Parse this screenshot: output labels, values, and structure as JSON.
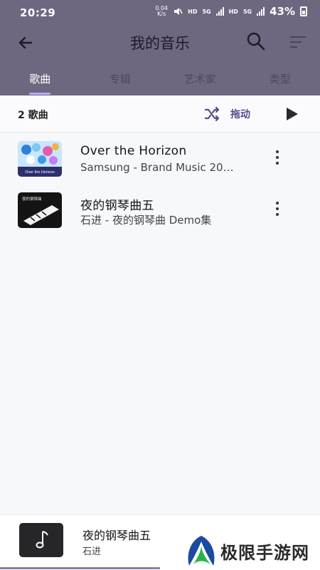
{
  "status_bar": {
    "time": "20:29",
    "net_speed_value": "0.04",
    "net_speed_unit": "K/s",
    "hd1": "HD",
    "net1": "5G",
    "hd2": "HD",
    "net2": "5G",
    "battery": "43%"
  },
  "header": {
    "title": "我的音乐",
    "tabs": [
      {
        "label": "歌曲",
        "active": true
      },
      {
        "label": "专辑",
        "active": false
      },
      {
        "label": "艺术家",
        "active": false
      },
      {
        "label": "类型",
        "active": false
      }
    ]
  },
  "toolbar": {
    "count": "2 歌曲",
    "shuffle_label": "拖动"
  },
  "songs": [
    {
      "title": "Over the Horizon",
      "subtitle": "Samsung - Brand Music 20…",
      "art_text": "Over the Horizon"
    },
    {
      "title": "夜的钢琴曲五",
      "subtitle": "石进 - 夜的钢琴曲 Demo集",
      "art_text": "夜的钢琴曲"
    }
  ],
  "now_playing": {
    "title": "夜的钢琴曲五",
    "artist": "石进",
    "progress": 0.5
  },
  "watermark": {
    "text": "极限手游网"
  },
  "colors": {
    "header_bg": "#6f6680",
    "accent": "#5a4a8e",
    "tab_indicator": "#b9a8ff"
  }
}
